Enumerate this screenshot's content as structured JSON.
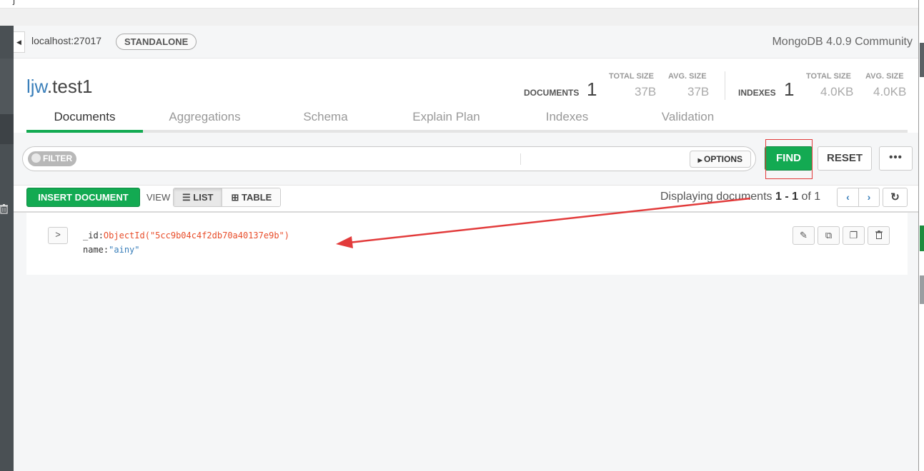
{
  "window": {
    "top_glyph": "j"
  },
  "instance": {
    "host": "localhost:27017",
    "topology": "STANDALONE",
    "version": "MongoDB 4.0.9 Community"
  },
  "collection": {
    "database": "ljw",
    "name": ".test1",
    "documents_label": "DOCUMENTS",
    "documents_count": "1",
    "doc_total_size_label": "TOTAL SIZE",
    "doc_total_size": "37B",
    "doc_avg_size_label": "AVG. SIZE",
    "doc_avg_size": "37B",
    "indexes_label": "INDEXES",
    "indexes_count": "1",
    "idx_total_size_label": "TOTAL SIZE",
    "idx_total_size": "4.0KB",
    "idx_avg_size_label": "AVG. SIZE",
    "idx_avg_size": "4.0KB"
  },
  "tabs": [
    {
      "label": "Documents",
      "active": true
    },
    {
      "label": "Aggregations"
    },
    {
      "label": "Schema"
    },
    {
      "label": "Explain Plan"
    },
    {
      "label": "Indexes"
    },
    {
      "label": "Validation"
    }
  ],
  "query_bar": {
    "filter_label": "FILTER",
    "options_label": "OPTIONS",
    "find_label": "FIND",
    "reset_label": "RESET",
    "more_label": "•••"
  },
  "toolbar": {
    "insert_label": "INSERT DOCUMENT",
    "view_label": "VIEW",
    "list_label": "LIST",
    "table_label": "TABLE",
    "display_prefix": "Displaying documents",
    "display_range": "1 - 1",
    "display_of": "of",
    "display_total": "1",
    "prev_icon": "‹",
    "next_icon": "›",
    "refresh_icon": "↻"
  },
  "document": {
    "expand_icon": ">",
    "fields": [
      {
        "key": "_id",
        "value": "ObjectId(\"5cc9b04c4f2db70a40137e9b\")",
        "type": "oid"
      },
      {
        "key": "name",
        "value": "\"ainy\"",
        "type": "string"
      }
    ]
  },
  "colors": {
    "accent_green": "#13aa52",
    "link_blue": "#3a7fba",
    "annotation_red": "#e23b3b"
  }
}
